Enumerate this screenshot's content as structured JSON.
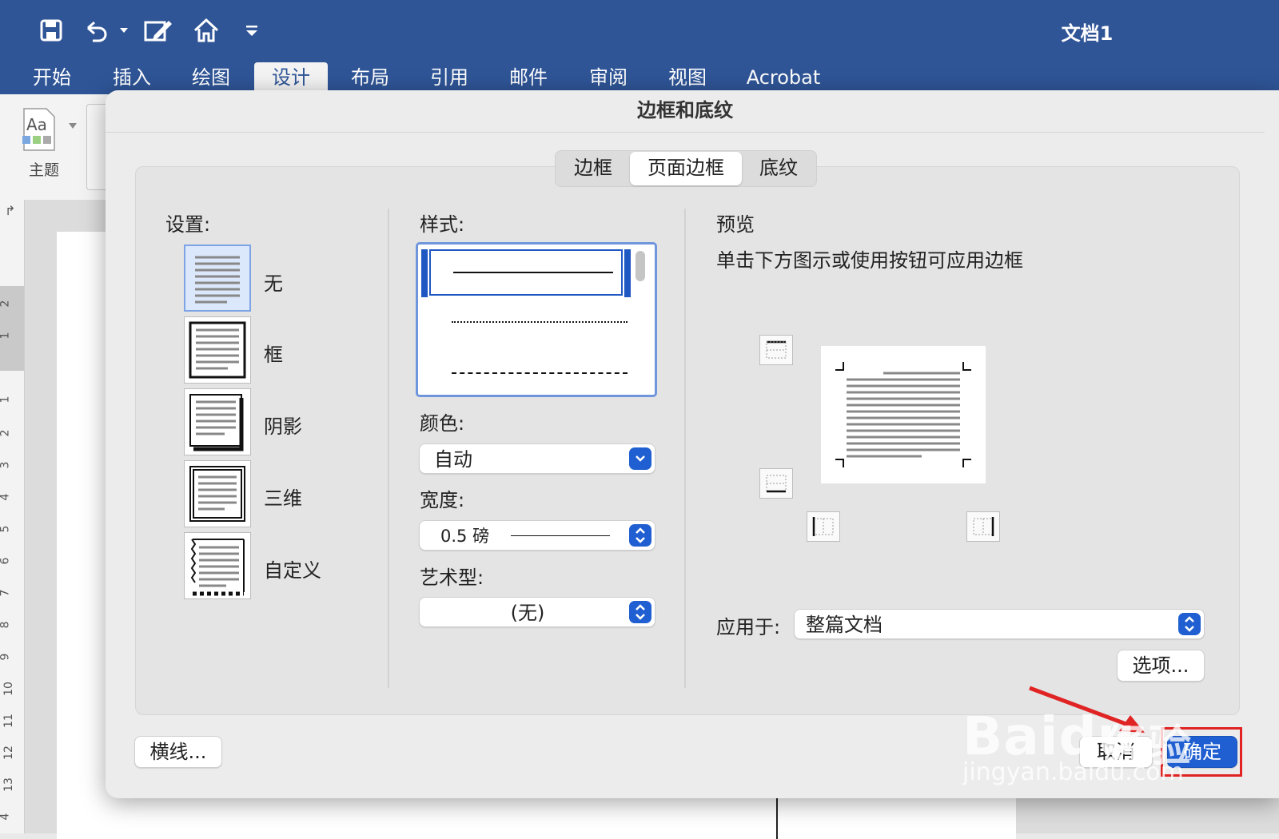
{
  "titlebar": {
    "doc_title": "文档1"
  },
  "tabs": [
    "开始",
    "插入",
    "绘图",
    "设计",
    "布局",
    "引用",
    "邮件",
    "审阅",
    "视图",
    "Acrobat"
  ],
  "ribbon": {
    "theme_label": "主题",
    "theme_glyph": "Aa"
  },
  "ruler_numbers": [
    "2",
    "1",
    "1",
    "2",
    "3",
    "4",
    "5",
    "6",
    "7",
    "8",
    "9",
    "10",
    "11",
    "12",
    "13",
    "4"
  ],
  "dialog": {
    "title": "边框和底纹",
    "segments": [
      "边框",
      "页面边框",
      "底纹"
    ],
    "selected_segment": "页面边框",
    "settings_label": "设置:",
    "settings": [
      "无",
      "框",
      "阴影",
      "三维",
      "自定义"
    ],
    "style_label": "样式:",
    "color_label": "颜色:",
    "color_value": "自动",
    "width_label": "宽度:",
    "width_value": "0.5 磅",
    "art_label": "艺术型:",
    "art_value": "(无)",
    "preview_label": "预览",
    "preview_hint": "单击下方图示或使用按钮可应用边框",
    "apply_label": "应用于:",
    "apply_value": "整篇文档",
    "options_button": "选项...",
    "horizontal_line_button": "横线...",
    "cancel_button": "取消",
    "ok_button": "确定"
  },
  "watermark": {
    "brand": "Baidu",
    "brand_cn": "经验",
    "url": "jingyan.baidu.com"
  },
  "colors": {
    "titlebar": "#2f5597",
    "accent": "#1f5fd1",
    "highlight": "#e02424"
  }
}
